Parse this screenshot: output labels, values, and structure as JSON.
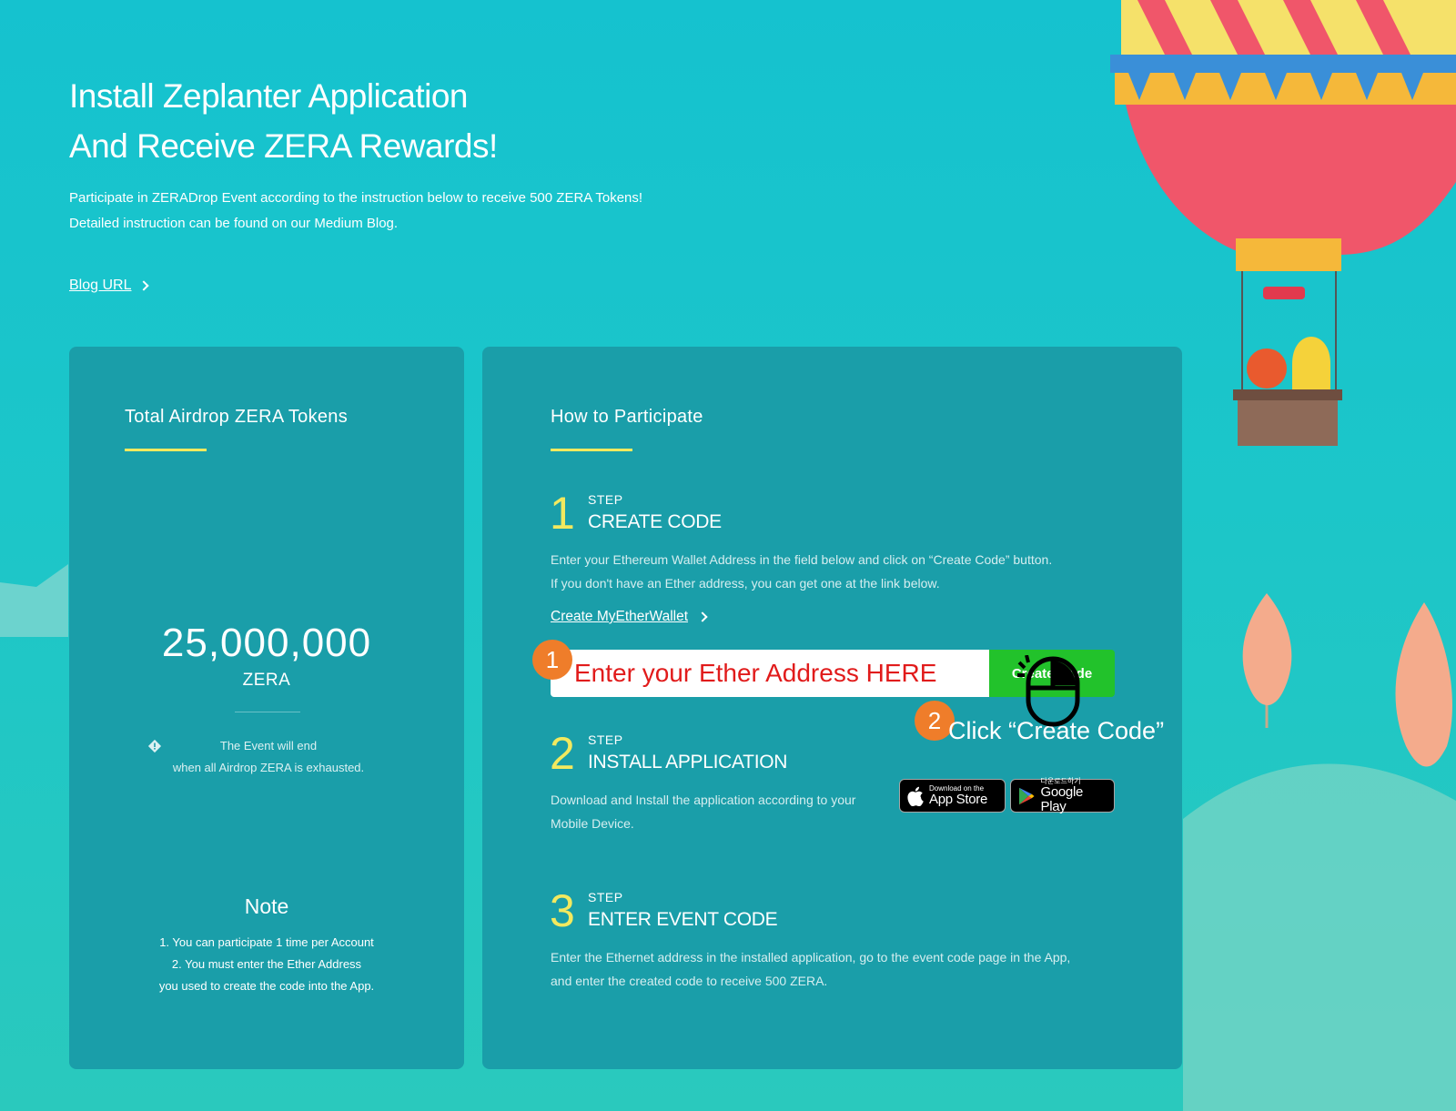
{
  "hero": {
    "title_line1": "Install Zeplanter Application",
    "title_line2": "And Receive ZERA Rewards!",
    "desc_line1": "Participate in ZERADrop Event according to the instruction below to receive 500 ZERA Tokens!",
    "desc_line2": "Detailed instruction can be found on our Medium Blog.",
    "blog_link": "Blog URL"
  },
  "left_card": {
    "title": "Total Airdrop ZERA Tokens",
    "total_value": "25,000,000",
    "total_unit": "ZERA",
    "notice_line1": "The Event will end",
    "notice_line2": "when all Airdrop ZERA is exhausted.",
    "note_title": "Note",
    "note_lines": [
      "1. You can participate 1 time per Account",
      "2. You must enter the Ether Address",
      "you used to create the code into the App."
    ]
  },
  "right_card": {
    "title": "How to Participate",
    "steps": [
      {
        "number": "1",
        "label": "STEP",
        "heading": "CREATE CODE",
        "desc_lines": [
          "Enter your Ethereum Wallet Address in the field below and click on “Create Code” button.",
          "If you don't have an Ether address, you can get one at the link below."
        ]
      },
      {
        "number": "2",
        "label": "STEP",
        "heading": "INSTALL APPLICATION",
        "desc_lines": [
          "Download and Install the application according to your",
          "Mobile Device."
        ]
      },
      {
        "number": "3",
        "label": "STEP",
        "heading": "ENTER EVENT CODE",
        "desc_lines": [
          "Enter the Ethernet address in the installed application, go to the event code page in the App,",
          "and enter the created code to receive 500 ZERA."
        ]
      }
    ],
    "wallet_link": "Create MyEtherWallet",
    "address_placeholder": "Enter your Ether Address HERE",
    "create_button": "Create Code",
    "app_store": {
      "small": "Download on the",
      "big": "App Store"
    },
    "google_play": {
      "small": "다운로드하기",
      "big": "Google Play"
    }
  },
  "annotations": {
    "badge1": "1",
    "badge2": "2",
    "click_text": "Click “Create Code”"
  },
  "colors": {
    "background": "#15c2cf",
    "card": "#1a9ea9",
    "accent_yellow": "#f2e95f",
    "button_green": "#22c22b",
    "annotation_orange": "#ef7d2a",
    "input_text_red": "#e11b1b"
  }
}
